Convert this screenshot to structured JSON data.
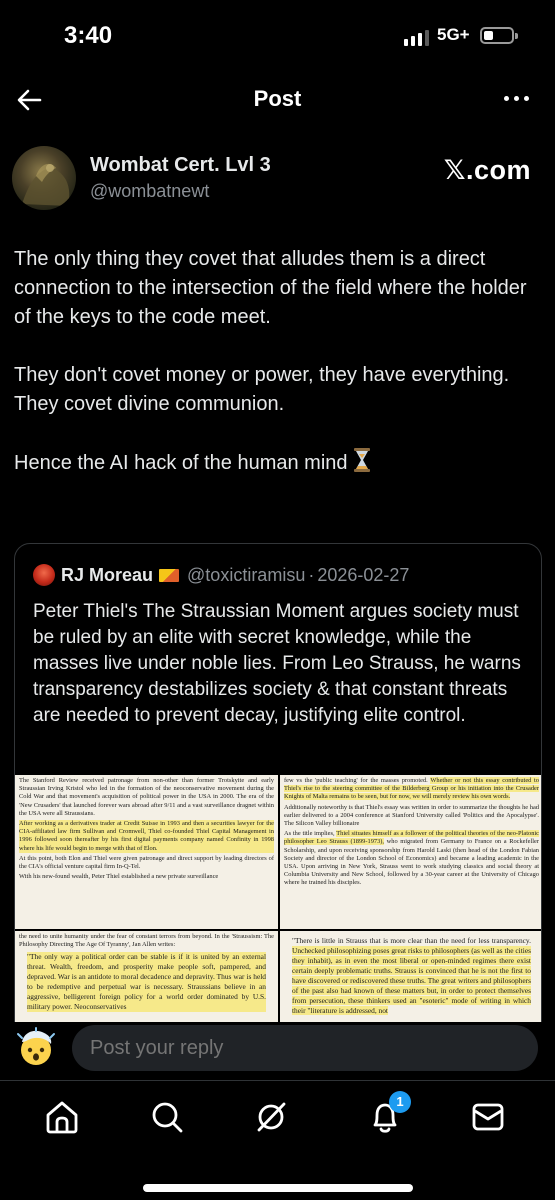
{
  "status_bar": {
    "time": "3:40",
    "network": "5G+"
  },
  "header": {
    "title": "Post"
  },
  "tweet": {
    "author_name": "Wombat Cert. Lvl 3",
    "author_handle": "@wombatnewt",
    "brand": "𝕏.com",
    "paragraphs": [
      "The only thing they covet that alludes them is a direct connection to the intersection of the field where the holder of the keys to the code meet.",
      "They don't covet money or power, they have everything. They covet divine communion.",
      "Hence the AI hack of the human mind"
    ]
  },
  "quote": {
    "author_name": "RJ Moreau",
    "author_handle": "@toxictiramisu",
    "separator": "·",
    "date": "2026-02-27",
    "text": "Peter Thiel's The Straussian Moment argues society must be ruled by an elite with secret knowledge, while the masses live under noble lies. From Leo Strauss, he warns transparency destabilizes society & that constant threats are needed to prevent decay, justifying elite control.",
    "documents": {
      "doc1": {
        "p1": "The Stanford Review received patronage from non-other than former Trotskyite and early Straussian Irving Kristol who led in the formation of the neoconservative movement during the Cold War and that movement's acquisition of political power in the USA in 2000. The era of the 'New Crusaders' that launched forever wars abroad after 9/11 and a vast surveillance dragnet within the USA were all Straussians.",
        "p2_hl": "After working as a derivatives trader at Credit Suisse in 1993 and then a securities lawyer for the CIA-affiliated law firm Sullivan and Cromwell, Thiel co-founded Thiel Capital Management in 1996 followed soon thereafter by his first digital payments company named Confinity in 1998 where his life would begin to merge with that of Elon.",
        "p3": "At this point, both Elon and Thiel were given patronage and direct support by leading directors of the CIA's official venture capital firm In-Q-Tel.",
        "p4": "With his new-found wealth, Peter Thiel established a new private surveillance"
      },
      "doc2": {
        "p1": "few vs the 'public teaching' for the masses promoted.",
        "p1_hl": "Whether or not this essay contributed to Thiel's rise to the steering committee of the Bilderberg Group or his initiation into the Crusader Knights of Malta remains to be seen, but for now, we will merely review his own words.",
        "p2": "Additionally noteworthy is that Thiel's essay was written in order to summarize the thoughts he had earlier delivered to a 2004 conference at Stanford University called 'Politics and the Apocalypse'. The Silicon Valley billionaire",
        "p3a": "As the title implies,",
        "p3_hl": "Thiel situates himself as a follower of the political theories of the neo-Platonic philosopher Leo Strauss (1899-1973),",
        "p3b": "who migrated from Germany to France on a Rockefeller Scholarship, and upon receiving sponsorship from Harold Laski (then head of the London Fabian Society and director of the London School of Economics) and became a leading academic in the USA. Upon arriving in New York, Strauss went to work studying classics and social theory at Columbia University and New School, followed by a 30-year career at the University of Chicago where he trained his disciples."
      },
      "doc3": {
        "p1": "the need to unite humanity under the fear of constant terrors from beyond. In the 'Straussism: The Philosophy Directing The Age Of Tyranny', Jan Allen writes:",
        "quote": "\"The only way a political order can be stable is if it is united by an external threat. Wealth, freedom, and prosperity make people soft, pampered, and depraved. War is an antidote to moral decadence and depravity. Thus war is held to be redemptive and perpetual war is necessary. Straussians believe in an aggressive, belligerent foreign policy for a world order dominated by U.S. military power. Neoconservatives"
      },
      "doc4": {
        "p1a": "\"There is little in Strauss that is more clear than the need for less transparency.",
        "p1_hl": "Unchecked philosophizing poses great risks to philosophers (as well as the cities they inhabit), as in even the most liberal or open-minded regimes there exist certain deeply problematic truths. Strauss is convinced that he is not the first to have discovered or rediscovered these truths. The great writers and philosophers of the past also had known of these matters but, in order to protect themselves from persecution, these thinkers used an \"esoteric\" mode of writing in which their \"literature is addressed, not"
      }
    }
  },
  "reply": {
    "placeholder": "Post your reply"
  },
  "nav": {
    "notification_count": "1"
  }
}
